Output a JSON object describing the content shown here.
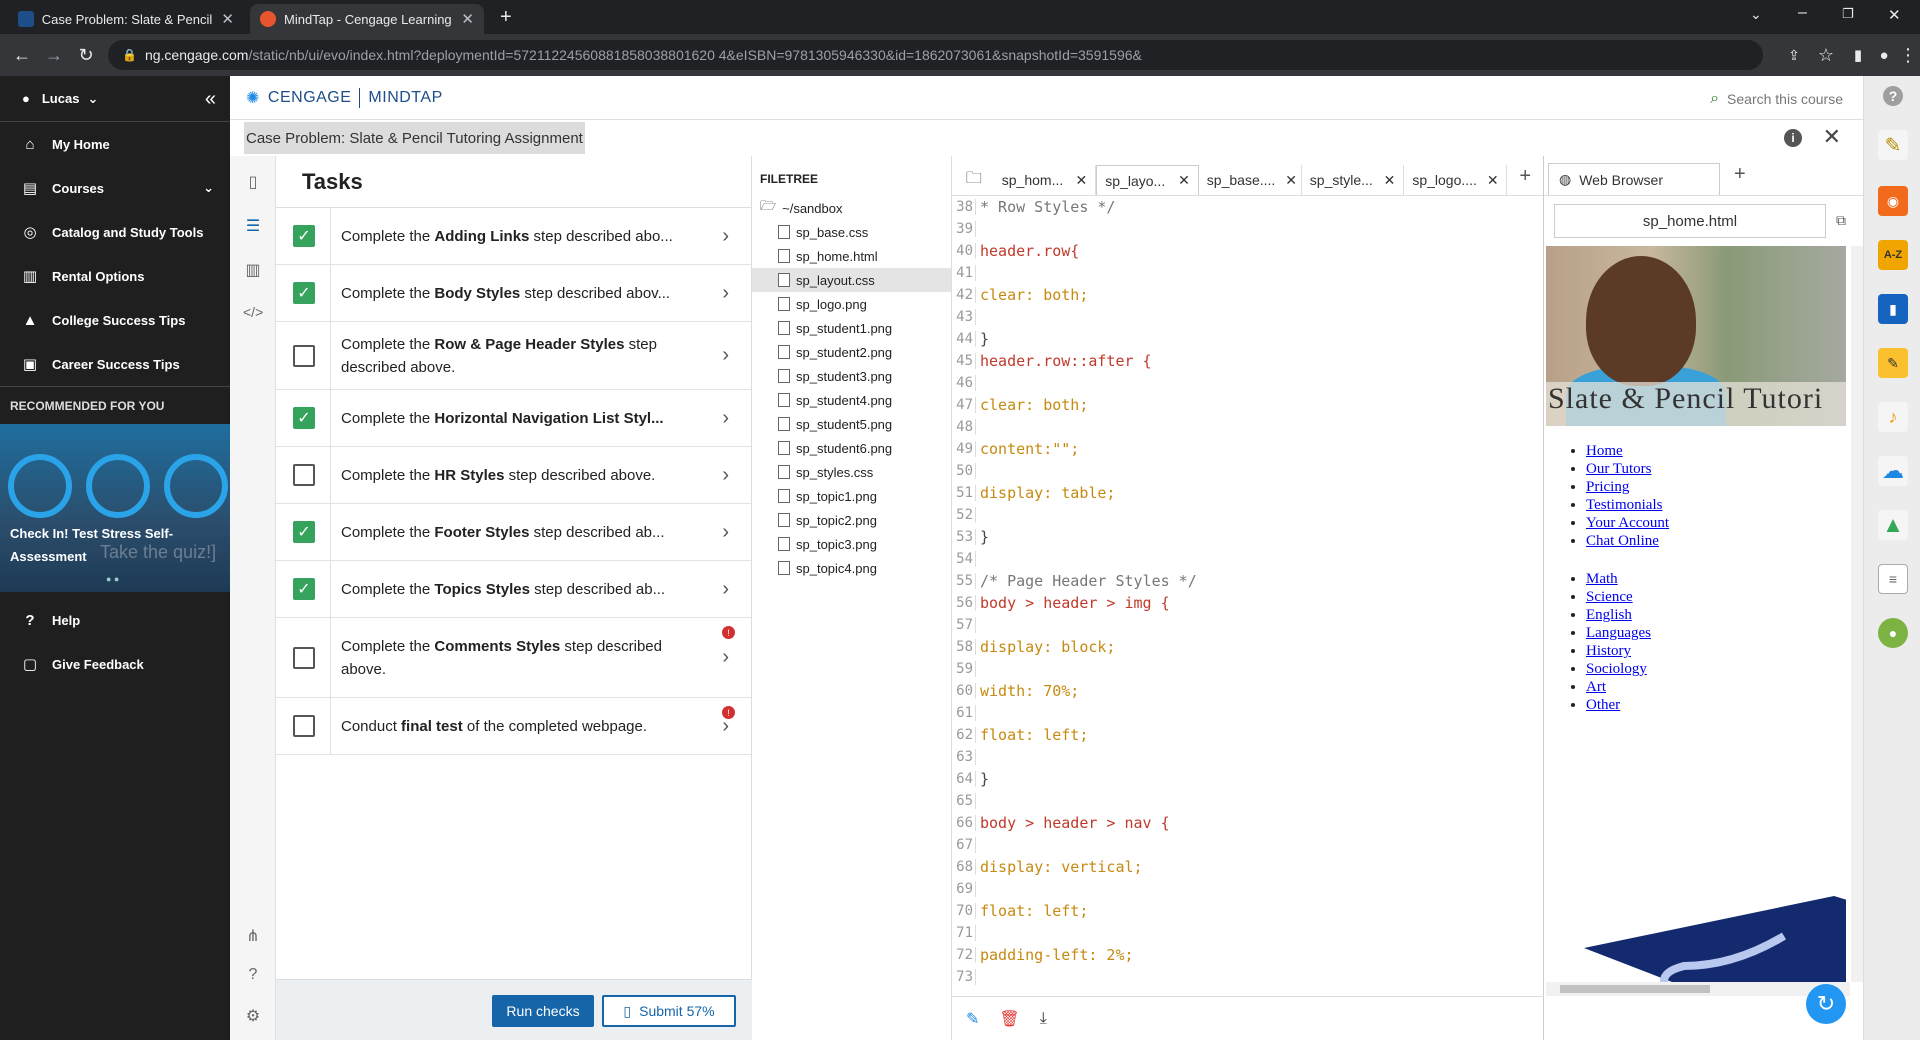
{
  "browser": {
    "tabs": [
      {
        "title": "Case Problem: Slate & Pencil Tuto",
        "favicon": "mindtap-mt-icon"
      },
      {
        "title": "MindTap - Cengage Learning",
        "favicon": "cengage-icon"
      }
    ],
    "url_domain": "ng.cengage.com",
    "url_path": "/static/nb/ui/evo/index.html?deploymentId=57211224560881858038801620 4&eISBN=9781305946330&id=1862073061&snapshotId=3591596&"
  },
  "sidebar": {
    "user": "Lucas",
    "items": [
      {
        "label": "My Home",
        "icon": "home-icon"
      },
      {
        "label": "Courses",
        "icon": "book-icon"
      },
      {
        "label": "Catalog and Study Tools",
        "icon": "compass-icon"
      },
      {
        "label": "Rental Options",
        "icon": "book-open-icon"
      },
      {
        "label": "College Success Tips",
        "icon": "graduation-cap-icon"
      },
      {
        "label": "Career Success Tips",
        "icon": "briefcase-icon"
      }
    ],
    "recommended_label": "RECOMMENDED FOR YOU",
    "promo_title_1": "Check In! Test Stress Self-",
    "promo_title_2": "Assessment",
    "promo_quiz": "Take the quiz!]",
    "help": "Help",
    "feedback": "Give Feedback"
  },
  "header": {
    "brand_1": "CENGAGE",
    "brand_2": "MINDTAP",
    "search_placeholder": "Search this course",
    "assignment_title": "Case Problem: Slate & Pencil Tutoring Assignment"
  },
  "tasks": {
    "heading": "Tasks",
    "items": [
      {
        "pre": "Complete the ",
        "bold": "Adding Links",
        "post": " step described abo...",
        "checked": true,
        "badge": false
      },
      {
        "pre": "Complete the ",
        "bold": "Body Styles",
        "post": " step described abov...",
        "checked": true,
        "badge": false
      },
      {
        "pre": "Complete the ",
        "bold": "Row & Page Header Styles",
        "post": " step described above.",
        "checked": false,
        "badge": false
      },
      {
        "pre": "Complete the ",
        "bold": "Horizontal Navigation List Styl...",
        "post": "",
        "checked": true,
        "badge": false
      },
      {
        "pre": "Complete the ",
        "bold": "HR Styles",
        "post": " step described above.",
        "checked": false,
        "badge": false
      },
      {
        "pre": "Complete the ",
        "bold": "Footer Styles",
        "post": " step described ab...",
        "checked": true,
        "badge": false
      },
      {
        "pre": "Complete the ",
        "bold": "Topics Styles",
        "post": " step described ab...",
        "checked": true,
        "badge": false
      },
      {
        "pre": "Complete the ",
        "bold": "Comments Styles",
        "post": " step described above.",
        "checked": false,
        "badge": true
      },
      {
        "pre": "Conduct ",
        "bold": "final test",
        "post": " of the completed webpage.",
        "checked": false,
        "badge": true
      }
    ],
    "run_label": "Run checks",
    "submit_label": "Submit 57%"
  },
  "filetree": {
    "heading": "FILETREE",
    "root": "~/sandbox",
    "files": [
      "sp_base.css",
      "sp_home.html",
      "sp_layout.css",
      "sp_logo.png",
      "sp_student1.png",
      "sp_student2.png",
      "sp_student3.png",
      "sp_student4.png",
      "sp_student5.png",
      "sp_student6.png",
      "sp_styles.css",
      "sp_topic1.png",
      "sp_topic2.png",
      "sp_topic3.png",
      "sp_topic4.png"
    ],
    "selected": "sp_layout.css"
  },
  "editor": {
    "tabs": [
      "sp_hom...",
      "sp_layo...",
      "sp_base....",
      "sp_style...",
      "sp_logo...."
    ],
    "active_tab": 1,
    "lines": [
      {
        "n": "38",
        "t": "* Row Styles */",
        "k": "cm"
      },
      {
        "n": "39",
        "t": "",
        "k": ""
      },
      {
        "n": "40",
        "t": "header.row{",
        "k": "sel"
      },
      {
        "n": "41",
        "t": "",
        "k": ""
      },
      {
        "n": "42",
        "t": "clear: both;",
        "k": "prop"
      },
      {
        "n": "43",
        "t": "",
        "k": ""
      },
      {
        "n": "44",
        "t": "}",
        "k": "pun"
      },
      {
        "n": "45",
        "t": "header.row::after {",
        "k": "sel"
      },
      {
        "n": "46",
        "t": "",
        "k": ""
      },
      {
        "n": "47",
        "t": "clear: both;",
        "k": "prop"
      },
      {
        "n": "48",
        "t": "",
        "k": ""
      },
      {
        "n": "49",
        "t": "content:\"\";",
        "k": "prop"
      },
      {
        "n": "50",
        "t": "",
        "k": ""
      },
      {
        "n": "51",
        "t": "display: table;",
        "k": "prop"
      },
      {
        "n": "52",
        "t": "",
        "k": ""
      },
      {
        "n": "53",
        "t": "}",
        "k": "pun"
      },
      {
        "n": "54",
        "t": "",
        "k": ""
      },
      {
        "n": "55",
        "t": "/* Page Header Styles */",
        "k": "cm"
      },
      {
        "n": "56",
        "t": "body > header > img {",
        "k": "sel"
      },
      {
        "n": "57",
        "t": "",
        "k": ""
      },
      {
        "n": "58",
        "t": "display: block;",
        "k": "prop"
      },
      {
        "n": "59",
        "t": "",
        "k": ""
      },
      {
        "n": "60",
        "t": "width: 70%;",
        "k": "prop"
      },
      {
        "n": "61",
        "t": "",
        "k": ""
      },
      {
        "n": "62",
        "t": "float: left;",
        "k": "prop"
      },
      {
        "n": "63",
        "t": "",
        "k": ""
      },
      {
        "n": "64",
        "t": "}",
        "k": "pun"
      },
      {
        "n": "65",
        "t": "",
        "k": ""
      },
      {
        "n": "66",
        "t": "body > header > nav {",
        "k": "sel"
      },
      {
        "n": "67",
        "t": "",
        "k": ""
      },
      {
        "n": "68",
        "t": "display: vertical;",
        "k": "prop"
      },
      {
        "n": "69",
        "t": "",
        "k": ""
      },
      {
        "n": "70",
        "t": "float: left;",
        "k": "prop"
      },
      {
        "n": "71",
        "t": "",
        "k": ""
      },
      {
        "n": "72",
        "t": "padding-left: 2%;",
        "k": "prop"
      },
      {
        "n": "73",
        "t": "",
        "k": ""
      }
    ]
  },
  "preview": {
    "tab_title": "Web Browser",
    "url": "sp_home.html",
    "hero_text": "Slate & Pencil Tutori",
    "nav1": [
      "Home",
      "Our Tutors",
      "Pricing",
      "Testimonials",
      "Your Account",
      "Chat Online"
    ],
    "nav2": [
      "Math",
      "Science",
      "English",
      "Languages",
      "History",
      "Sociology",
      "Art",
      "Other"
    ]
  },
  "colors": {
    "accent": "#1565a8",
    "check": "#35a35b"
  }
}
